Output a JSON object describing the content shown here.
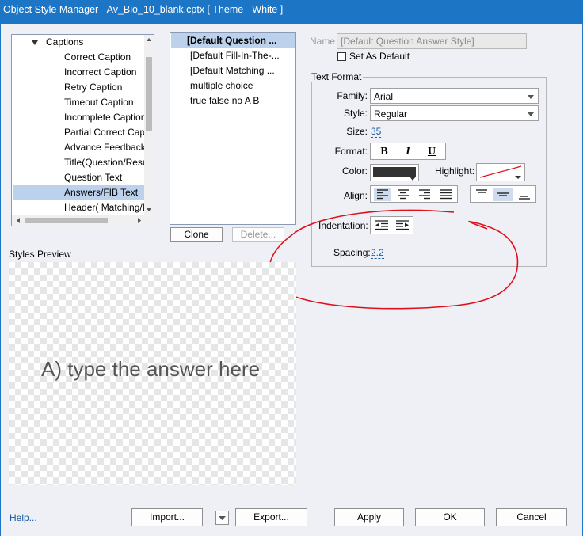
{
  "window": {
    "title": "Object Style Manager - Av_Bio_10_blank.cptx [ Theme - White ]"
  },
  "tree": {
    "group_label": "Captions",
    "items": [
      {
        "label": "Correct Caption"
      },
      {
        "label": "Incorrect Caption"
      },
      {
        "label": "Retry Caption"
      },
      {
        "label": "Timeout Caption"
      },
      {
        "label": "Incomplete Caption"
      },
      {
        "label": "Partial Correct Caption"
      },
      {
        "label": "Advance Feedback Caption"
      },
      {
        "label": "Title(Question/Result)"
      },
      {
        "label": "Question Text"
      },
      {
        "label": "Answers/FIB Text",
        "selected": true
      },
      {
        "label": "Header( Matching/Likert)"
      }
    ]
  },
  "styles_list": {
    "items": [
      {
        "label": "[Default Question ...",
        "selected": true
      },
      {
        "label": "[Default Fill-In-The-..."
      },
      {
        "label": "[Default Matching  ..."
      },
      {
        "label": "multiple choice"
      },
      {
        "label": "true false no A B"
      }
    ],
    "clone_label": "Clone",
    "delete_label": "Delete..."
  },
  "name_field": {
    "label": "Name",
    "value": "[Default Question Answer Style]"
  },
  "set_default": {
    "label": "Set As Default",
    "checked": false
  },
  "text_format": {
    "group_label": "Text Format",
    "family_label": "Family:",
    "family_value": "Arial",
    "style_label": "Style:",
    "style_value": "Regular",
    "size_label": "Size:",
    "size_value": "35",
    "format_label": "Format:",
    "bold_glyph": "B",
    "italic_glyph": "I",
    "underline_glyph": "U",
    "color_label": "Color:",
    "text_color": "#333333",
    "highlight_label": "Highlight:",
    "align_label": "Align:",
    "indentation_label": "Indentation:",
    "spacing_label": "Spacing:",
    "spacing_value": "2.2"
  },
  "preview": {
    "label": "Styles Preview",
    "sample_text": "A) type the answer here",
    "text_color": "#555555"
  },
  "footer": {
    "help_label": "Help...",
    "import_label": "Import...",
    "export_label": "Export...",
    "apply_label": "Apply",
    "ok_label": "OK",
    "cancel_label": "Cancel"
  },
  "colors": {
    "title_bar": "#1c75c5",
    "selection": "#bcd1ec",
    "annotation": "#e0101a",
    "link": "#1c5aa6"
  }
}
